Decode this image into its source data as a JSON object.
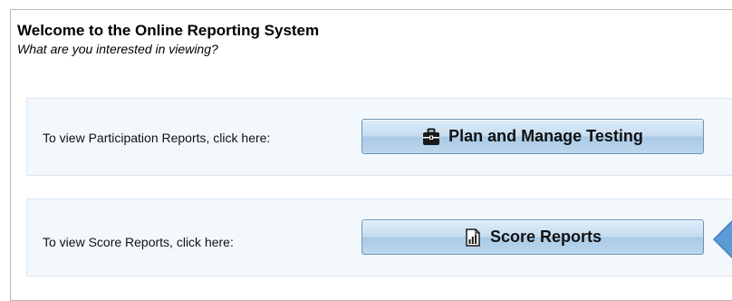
{
  "welcome": {
    "title": "Welcome to the Online Reporting System",
    "subtitle": "What are you interested in viewing?"
  },
  "sections": [
    {
      "prompt": "To view Participation Reports, click here:",
      "button_label": "Plan and Manage Testing",
      "icon": "briefcase-icon"
    },
    {
      "prompt": "To view Score Reports, click here:",
      "button_label": "Score Reports",
      "icon": "bar-chart-document-icon"
    }
  ],
  "colors": {
    "section_background": "#f3f8fd",
    "button_gradient_top": "#ddecf8",
    "button_gradient_bottom": "#a9cae6",
    "button_border": "#6f95b6",
    "pointer_arrow": "#5b9bd5"
  }
}
